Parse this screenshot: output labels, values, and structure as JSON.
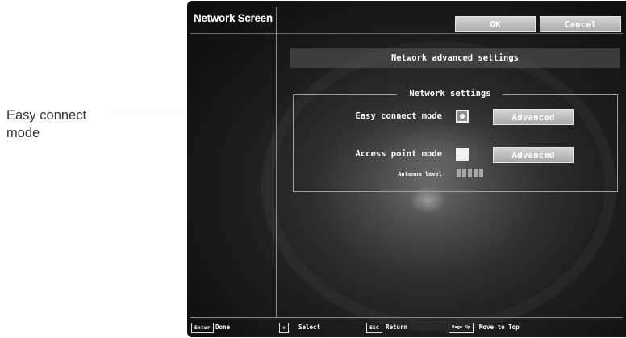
{
  "callout": {
    "line1": "Easy connect",
    "line2": "mode"
  },
  "screen": {
    "title": "Network Screen",
    "ok_label": "OK",
    "cancel_label": "Cancel",
    "header": "Network advanced settings",
    "group_title": "Network settings",
    "easy_connect": {
      "label": "Easy connect mode",
      "checked": true,
      "advanced_label": "Advanced"
    },
    "access_point": {
      "label": "Access point mode",
      "checked": false,
      "advanced_label": "Advanced"
    },
    "antenna": {
      "label": "Antenna level",
      "bars": 5
    }
  },
  "footer": [
    {
      "key": "Enter",
      "action": "Done"
    },
    {
      "key": "✥",
      "action": "Select"
    },
    {
      "key": "ESC",
      "action": "Return"
    },
    {
      "key": "Page Up",
      "action": "Move to Top"
    }
  ]
}
